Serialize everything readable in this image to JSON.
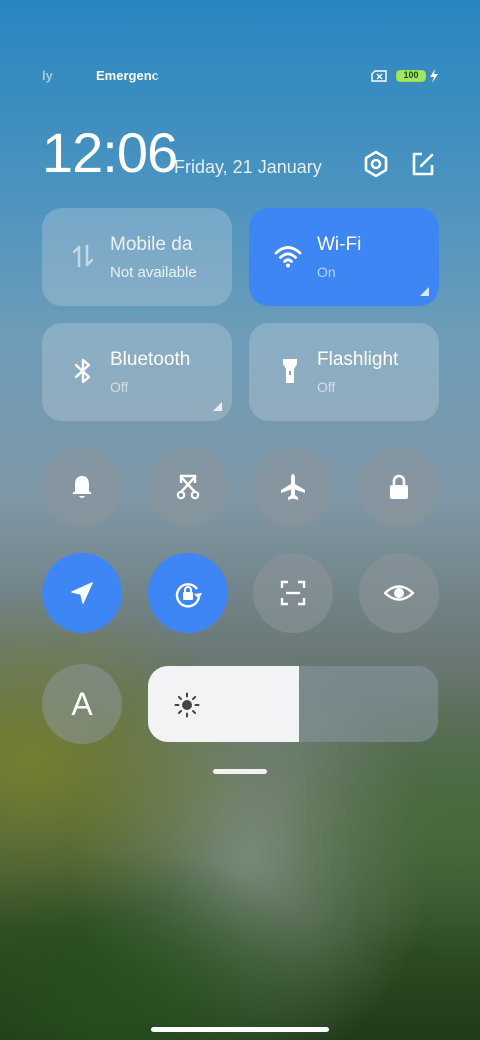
{
  "status_bar": {
    "carrier1": "ly",
    "carrier2": "Emergenc",
    "battery_level": "100",
    "battery_color": "#a4e663"
  },
  "header": {
    "time": "12:06",
    "date": "Friday, 21 January",
    "settings_icon": "gear-hexagon-icon",
    "edit_icon": "edit-icon"
  },
  "tiles": {
    "mobile_data": {
      "title": "Mobile da",
      "subtitle": "Not available",
      "active": false
    },
    "wifi": {
      "title": "Wi-Fi",
      "subtitle": "On",
      "active": true
    },
    "bluetooth": {
      "title": "Bluetooth",
      "subtitle": "Off",
      "active": false
    },
    "flashlight": {
      "title": "Flashlight",
      "subtitle": "Off",
      "active": false
    }
  },
  "toggles": [
    {
      "icon": "bell-icon",
      "active": false
    },
    {
      "icon": "screenshot-icon",
      "active": false
    },
    {
      "icon": "airplane-icon",
      "active": false
    },
    {
      "icon": "lock-icon",
      "active": false
    },
    {
      "icon": "location-icon",
      "active": true
    },
    {
      "icon": "rotation-lock-icon",
      "active": true
    },
    {
      "icon": "scanner-icon",
      "active": false
    },
    {
      "icon": "eye-icon",
      "active": false
    }
  ],
  "auto_brightness_label": "A",
  "brightness": {
    "level": 0.52
  },
  "colors": {
    "accent": "#3f86f5"
  }
}
